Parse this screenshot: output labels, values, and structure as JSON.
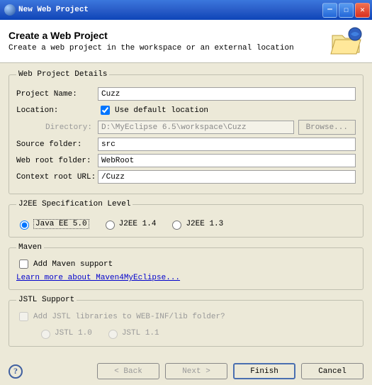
{
  "window": {
    "title": "New Web Project"
  },
  "header": {
    "title": "Create a Web Project",
    "subtitle": "Create a web project in the workspace or an external location"
  },
  "details": {
    "legend": "Web Project Details",
    "projectNameLabel": "Project Name:",
    "projectName": "Cuzz",
    "locationLabel": "Location:",
    "useDefaultLabel": "Use default location",
    "useDefaultChecked": true,
    "directoryLabel": "Directory:",
    "directory": "D:\\MyEclipse 6.5\\workspace\\Cuzz",
    "browseLabel": "Browse...",
    "sourceFolderLabel": "Source folder:",
    "sourceFolder": "src",
    "webRootLabel": "Web root folder:",
    "webRoot": "WebRoot",
    "contextRootLabel": "Context root URL:",
    "contextRoot": "/Cuzz"
  },
  "j2ee": {
    "legend": "J2EE Specification Level",
    "options": [
      "Java EE 5.0",
      "J2EE 1.4",
      "J2EE 1.3"
    ],
    "selected": "Java EE 5.0"
  },
  "maven": {
    "legend": "Maven",
    "addSupportLabel": "Add Maven support",
    "addSupportChecked": false,
    "learnMore": "Learn more about Maven4MyEclipse..."
  },
  "jstl": {
    "legend": "JSTL Support",
    "addLibsLabel": "Add JSTL libraries to WEB-INF/lib folder?",
    "options": [
      "JSTL 1.0",
      "JSTL 1.1"
    ]
  },
  "buttons": {
    "back": "< Back",
    "next": "Next >",
    "finish": "Finish",
    "cancel": "Cancel"
  }
}
